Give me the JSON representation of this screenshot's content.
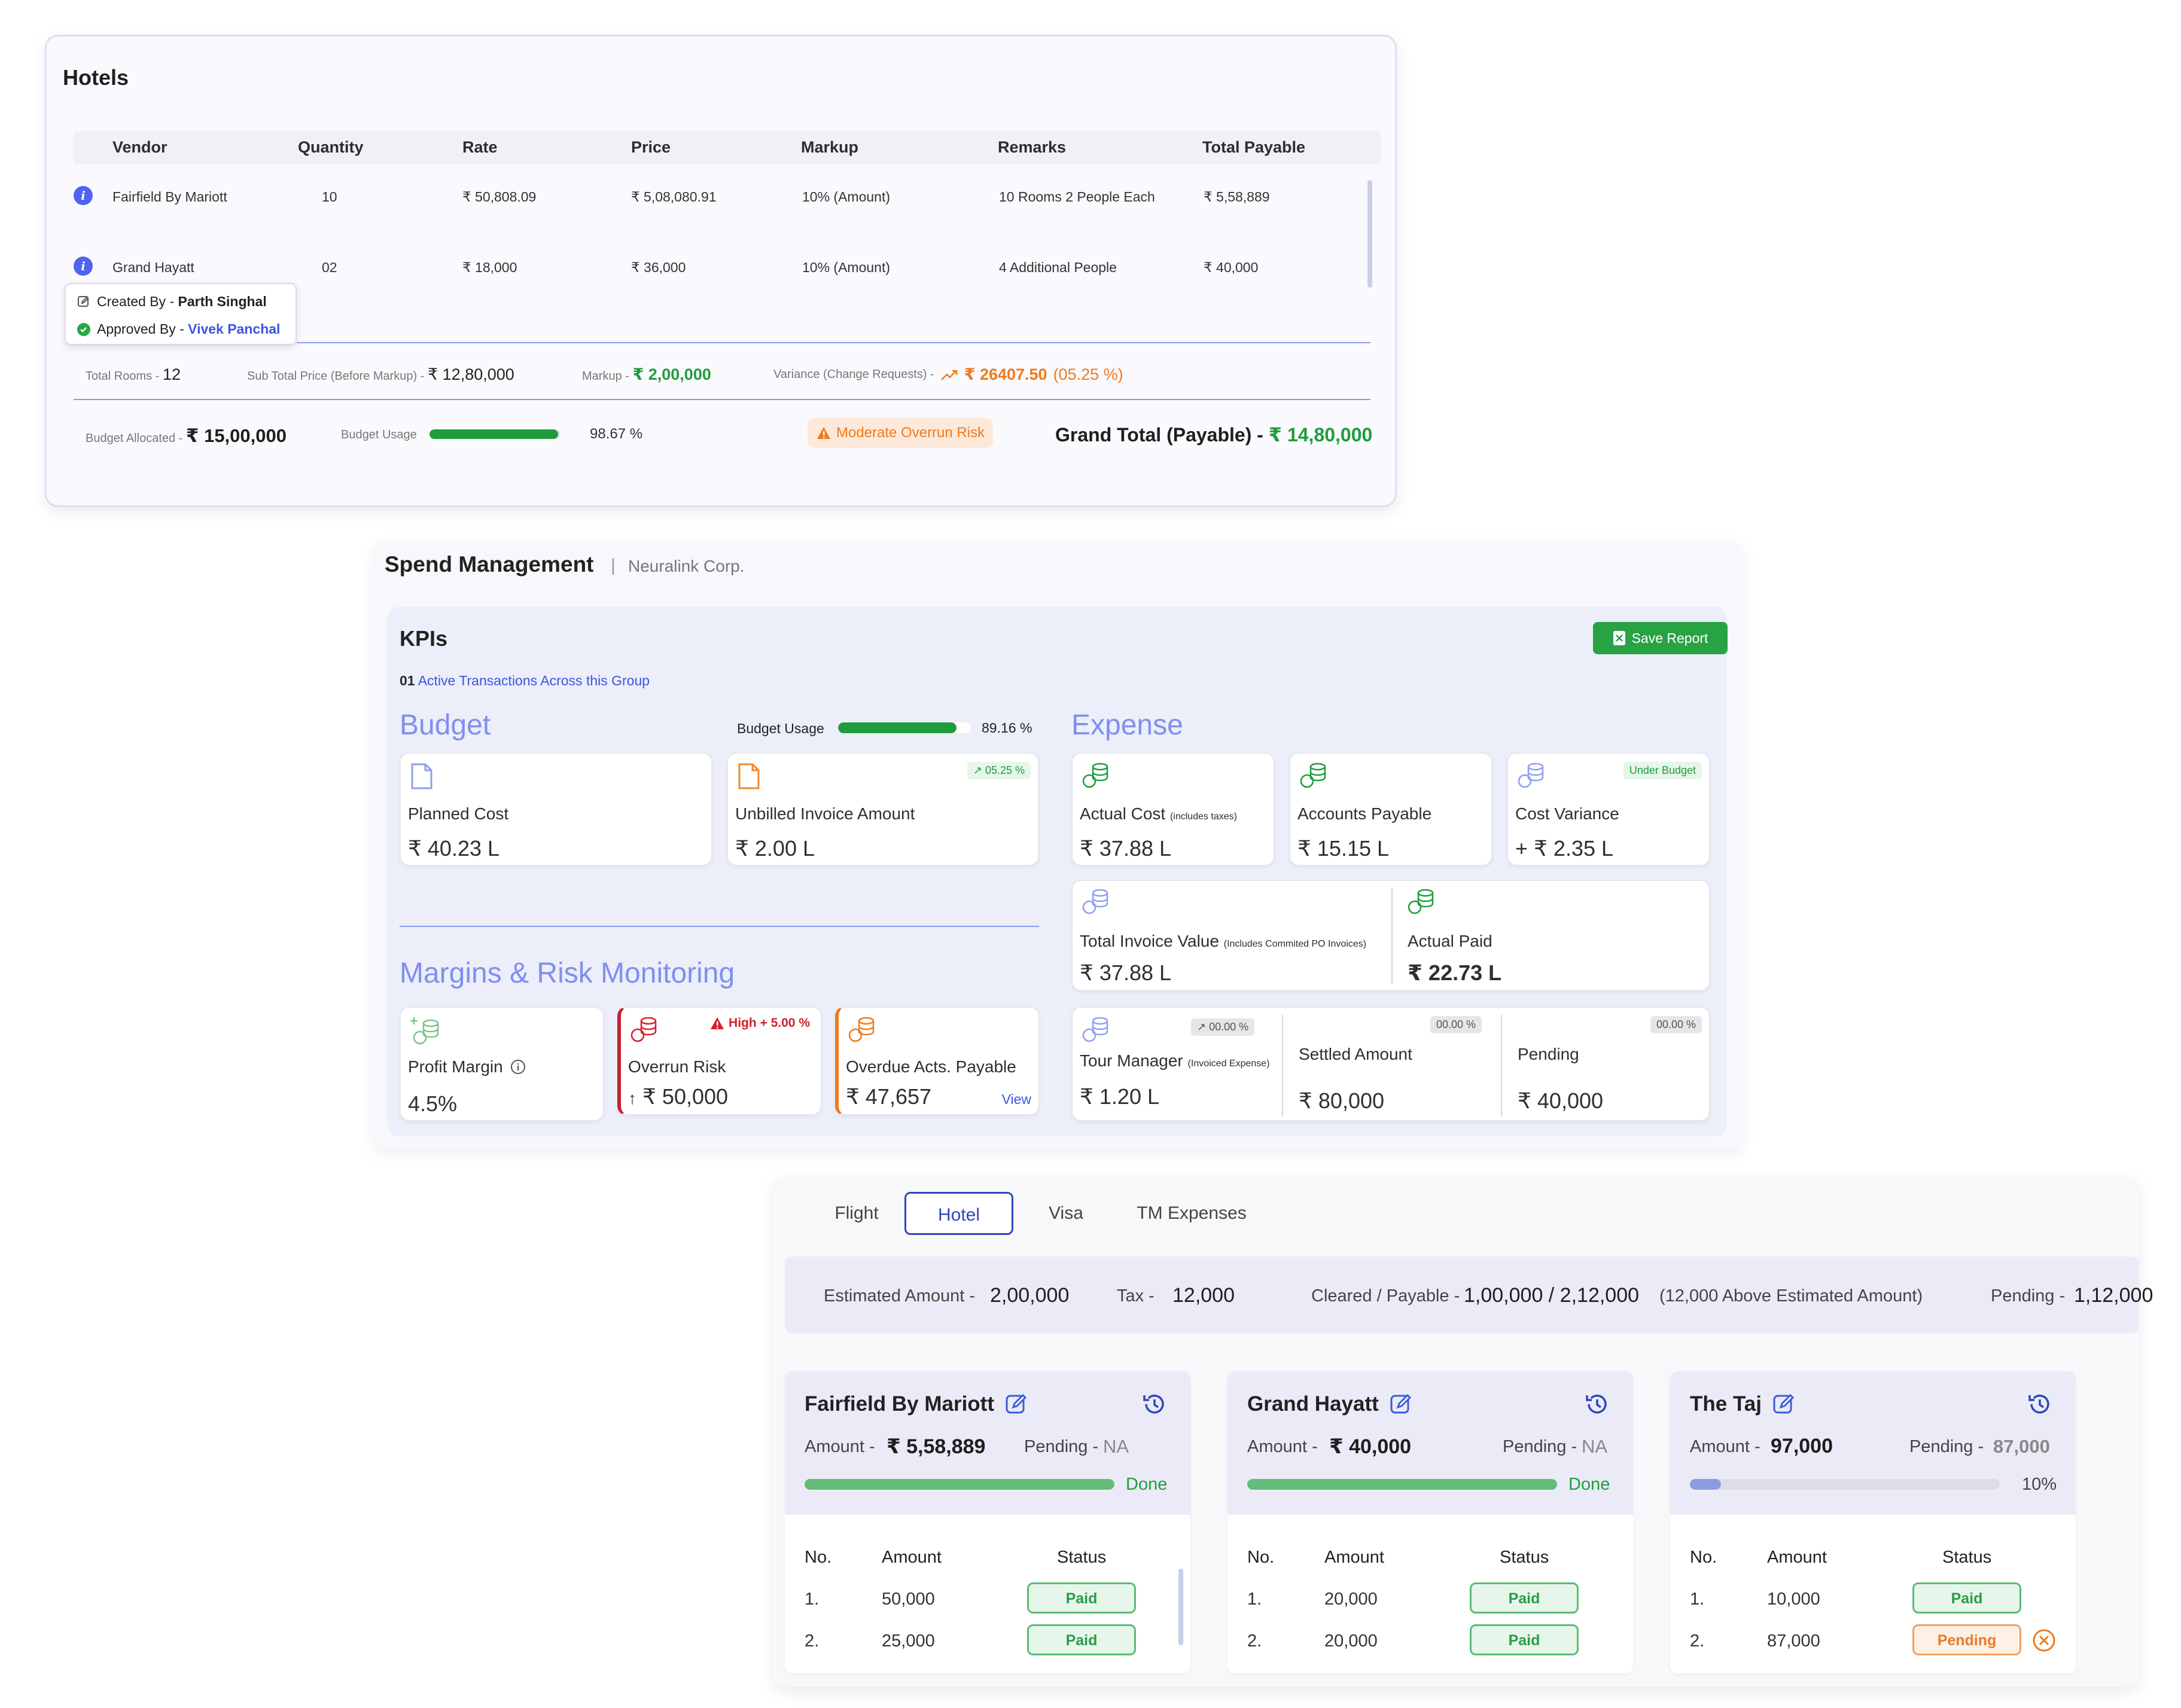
{
  "hotels": {
    "title": "Hotels",
    "columns": [
      "Vendor",
      "Quantity",
      "Rate",
      "Price",
      "Markup",
      "Remarks",
      "Total Payable"
    ],
    "rows": [
      {
        "vendor": "Fairfield By Mariott",
        "quantity": "10",
        "rate": "₹ 50,808.09",
        "price": "₹ 5,08,080.91",
        "markup": "10% (Amount)",
        "remarks": "10 Rooms 2 People Each",
        "total": "₹ 5,58,889"
      },
      {
        "vendor": "Grand Hayatt",
        "quantity": "02",
        "rate": "₹ 18,000",
        "price": "₹ 36,000",
        "markup": "10% (Amount)",
        "remarks": "4 Additional People",
        "total": "₹ 40,000"
      }
    ],
    "tooltip": {
      "created_label": "Created By - ",
      "created_name": "Parth Singhal",
      "approved_label": "Approved By - ",
      "approved_name": "Vivek Panchal"
    },
    "totals": {
      "rooms_label": "Total Rooms - ",
      "rooms_value": "12",
      "subtotal_label": "Sub Total Price (Before Markup) - ",
      "subtotal_value": "₹ 12,80,000",
      "markup_label": "Markup - ",
      "markup_value": "₹ 2,00,000",
      "variance_label": "Variance (Change Requests) - ",
      "variance_value": "₹ 26407.50",
      "variance_pct": "(05.25 %)"
    },
    "budget": {
      "allocated_label": "Budget Allocated - ",
      "allocated_value": "₹ 15,00,000",
      "usage_label": "Budget Usage",
      "usage_fraction": 0.9867,
      "usage_text": "98.67 %",
      "risk_label": "Moderate Overrun Risk",
      "grand_total_label": "Grand Total (Payable) - ",
      "grand_total_value": "₹ 14,80,000"
    }
  },
  "spend": {
    "title": "Spend Management",
    "separator": "|",
    "company": "Neuralink Corp.",
    "kpis_title": "KPIs",
    "save_label": "Save Report",
    "active_count": "01",
    "active_text": "Active Transactions Across this Group",
    "budget_title": "Budget",
    "budget_usage_label": "Budget Usage",
    "budget_usage_fraction": 0.8916,
    "budget_usage_text": "89.16 %",
    "expense_title": "Expense",
    "margins_title": "Margins & Risk Monitoring",
    "planned_label": "Planned Cost",
    "planned_value": "₹ 40.23 L",
    "unbilled_label": "Unbilled Invoice Amount",
    "unbilled_value": "₹ 2.00 L",
    "unbilled_badge": "05.25 %",
    "actual_label": "Actual Cost",
    "actual_note": "(includes taxes)",
    "actual_value": "₹ 37.88 L",
    "payable_label": "Accounts Payable",
    "payable_value": "₹ 15.15 L",
    "variance_label": "Cost Variance",
    "variance_value": "+ ₹ 2.35 L",
    "variance_badge": "Under Budget",
    "tiv_label": "Total Invoice Value",
    "tiv_note": "(Includes Commited PO Invoices)",
    "tiv_value": "₹ 37.88 L",
    "paid_label": "Actual Paid",
    "paid_value": "₹ 22.73 L",
    "profit_label": "Profit Margin",
    "profit_value": "4.5%",
    "overrun_label": "Overrun Risk",
    "overrun_badge": "High + 5.00 %",
    "overrun_arrow": "↑",
    "overrun_value": "₹ 50,000",
    "overdue_label": "Overdue Acts. Payable",
    "overdue_value": "₹ 47,657",
    "overdue_link": "View",
    "tm_label": "Tour Manager",
    "tm_note": "(Invoiced Expense)",
    "tm_value": "₹ 1.20 L",
    "tm_badge": "00.00 %",
    "settled_label": "Settled Amount",
    "settled_value": "₹ 80,000",
    "settled_badge": "00.00 %",
    "pending_label": "Pending",
    "pending_value": "₹ 40,000",
    "pending_badge": "00.00 %"
  },
  "tabs": {
    "items": [
      "Flight",
      "Hotel",
      "Visa",
      "TM Expenses"
    ],
    "active": "Hotel",
    "summary": {
      "est_label": "Estimated Amount - ",
      "est_value": "2,00,000",
      "tax_label": "Tax - ",
      "tax_value": "12,000",
      "cleared_label": "Cleared / Payable - ",
      "cleared_value": "1,00,000 / 2,12,000",
      "cleared_note": "(12,000 Above Estimated Amount)",
      "pending_label": "Pending - ",
      "pending_value": "1,12,000"
    },
    "col_no": "No.",
    "col_amount": "Amount",
    "col_status": "Status",
    "amount_label": "Amount - ",
    "pending_label": "Pending - ",
    "vendors": [
      {
        "name": "Fairfield By Mariott",
        "amount": "₹ 5,58,889",
        "pending": "NA",
        "progress": 1.0,
        "progress_text": "Done",
        "rows": [
          {
            "no": "1.",
            "amount": "50,000",
            "status": "Paid"
          },
          {
            "no": "2.",
            "amount": "25,000",
            "status": "Paid"
          }
        ]
      },
      {
        "name": "Grand Hayatt",
        "amount": "₹ 40,000",
        "pending": "NA",
        "progress": 1.0,
        "progress_text": "Done",
        "rows": [
          {
            "no": "1.",
            "amount": "20,000",
            "status": "Paid"
          },
          {
            "no": "2.",
            "amount": "20,000",
            "status": "Paid"
          }
        ]
      },
      {
        "name": "The Taj",
        "amount": "97,000",
        "pending": "87,000",
        "progress": 0.1,
        "progress_text": "10%",
        "rows": [
          {
            "no": "1.",
            "amount": "10,000",
            "status": "Paid"
          },
          {
            "no": "2.",
            "amount": "87,000",
            "status": "Pending"
          }
        ]
      }
    ]
  },
  "colors": {
    "accent_blue": "#7f8ff0",
    "green": "#1f9d3c",
    "orange": "#f07a1b",
    "red": "#d3202a",
    "tab_active": "#2f46b8"
  }
}
